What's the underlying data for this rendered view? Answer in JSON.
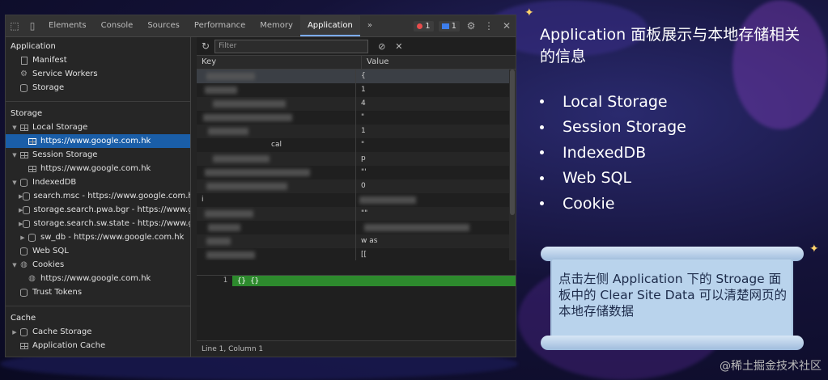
{
  "devtools": {
    "tabs": [
      "Elements",
      "Console",
      "Sources",
      "Performance",
      "Memory",
      "Application"
    ],
    "active_tab": "Application",
    "more_tabs_symbol": "»",
    "error_count": "1",
    "message_count": "1",
    "sidebar": {
      "application_header": "Application",
      "application_items": [
        "Manifest",
        "Service Workers",
        "Storage"
      ],
      "storage_header": "Storage",
      "local_storage": "Local Storage",
      "local_storage_origin": "https://www.google.com.hk",
      "session_storage": "Session Storage",
      "session_storage_origin": "https://www.google.com.hk",
      "indexeddb": "IndexedDB",
      "indexeddb_items": [
        "search.msc - https://www.google.com.hk",
        "storage.search.pwa.bgr - https://www.google.com.hk",
        "storage.search.sw.state - https://www.google.com.hk",
        "sw_db - https://www.google.com.hk"
      ],
      "web_sql": "Web SQL",
      "cookies": "Cookies",
      "cookies_origin": "https://www.google.com.hk",
      "trust_tokens": "Trust Tokens",
      "cache_header": "Cache",
      "cache_storage": "Cache Storage",
      "application_cache": "Application Cache"
    },
    "filter_placeholder": "Filter",
    "columns": {
      "key": "Key",
      "value": "Value"
    },
    "rows": [
      {
        "key": "",
        "value": "{"
      },
      {
        "key": "",
        "value": "1"
      },
      {
        "key": "",
        "value": "4"
      },
      {
        "key": "",
        "value": "\""
      },
      {
        "key": "",
        "value": "1"
      },
      {
        "key": "cal",
        "value": "\""
      },
      {
        "key": "",
        "value": "p"
      },
      {
        "key": "",
        "value": "\"'"
      },
      {
        "key": "",
        "value": "0"
      },
      {
        "key": "i",
        "value": ""
      },
      {
        "key": "",
        "value": "\"\""
      },
      {
        "key": "",
        "value": ""
      },
      {
        "key": "",
        "value": "w                as"
      },
      {
        "key": "",
        "value": "[["
      }
    ],
    "preview_line_number": "1",
    "preview_code": "{}  {}",
    "status": "Line 1, Column 1"
  },
  "slide": {
    "title": "Application 面板展示与本地存储相关的信息",
    "bullets": [
      "Local Storage",
      "Session Storage",
      "IndexedDB",
      "Web SQL",
      "Cookie"
    ],
    "note": "点击左侧 Application 下的 Stroage 面板中的 Clear Site Data 可以清楚网页的本地存储数据",
    "watermark": "@稀土掘金技术社区"
  },
  "colors": {
    "selection": "#1a5ea8",
    "preview_green": "#2d8a2d",
    "scroll_paper": "#b9d3ec"
  }
}
